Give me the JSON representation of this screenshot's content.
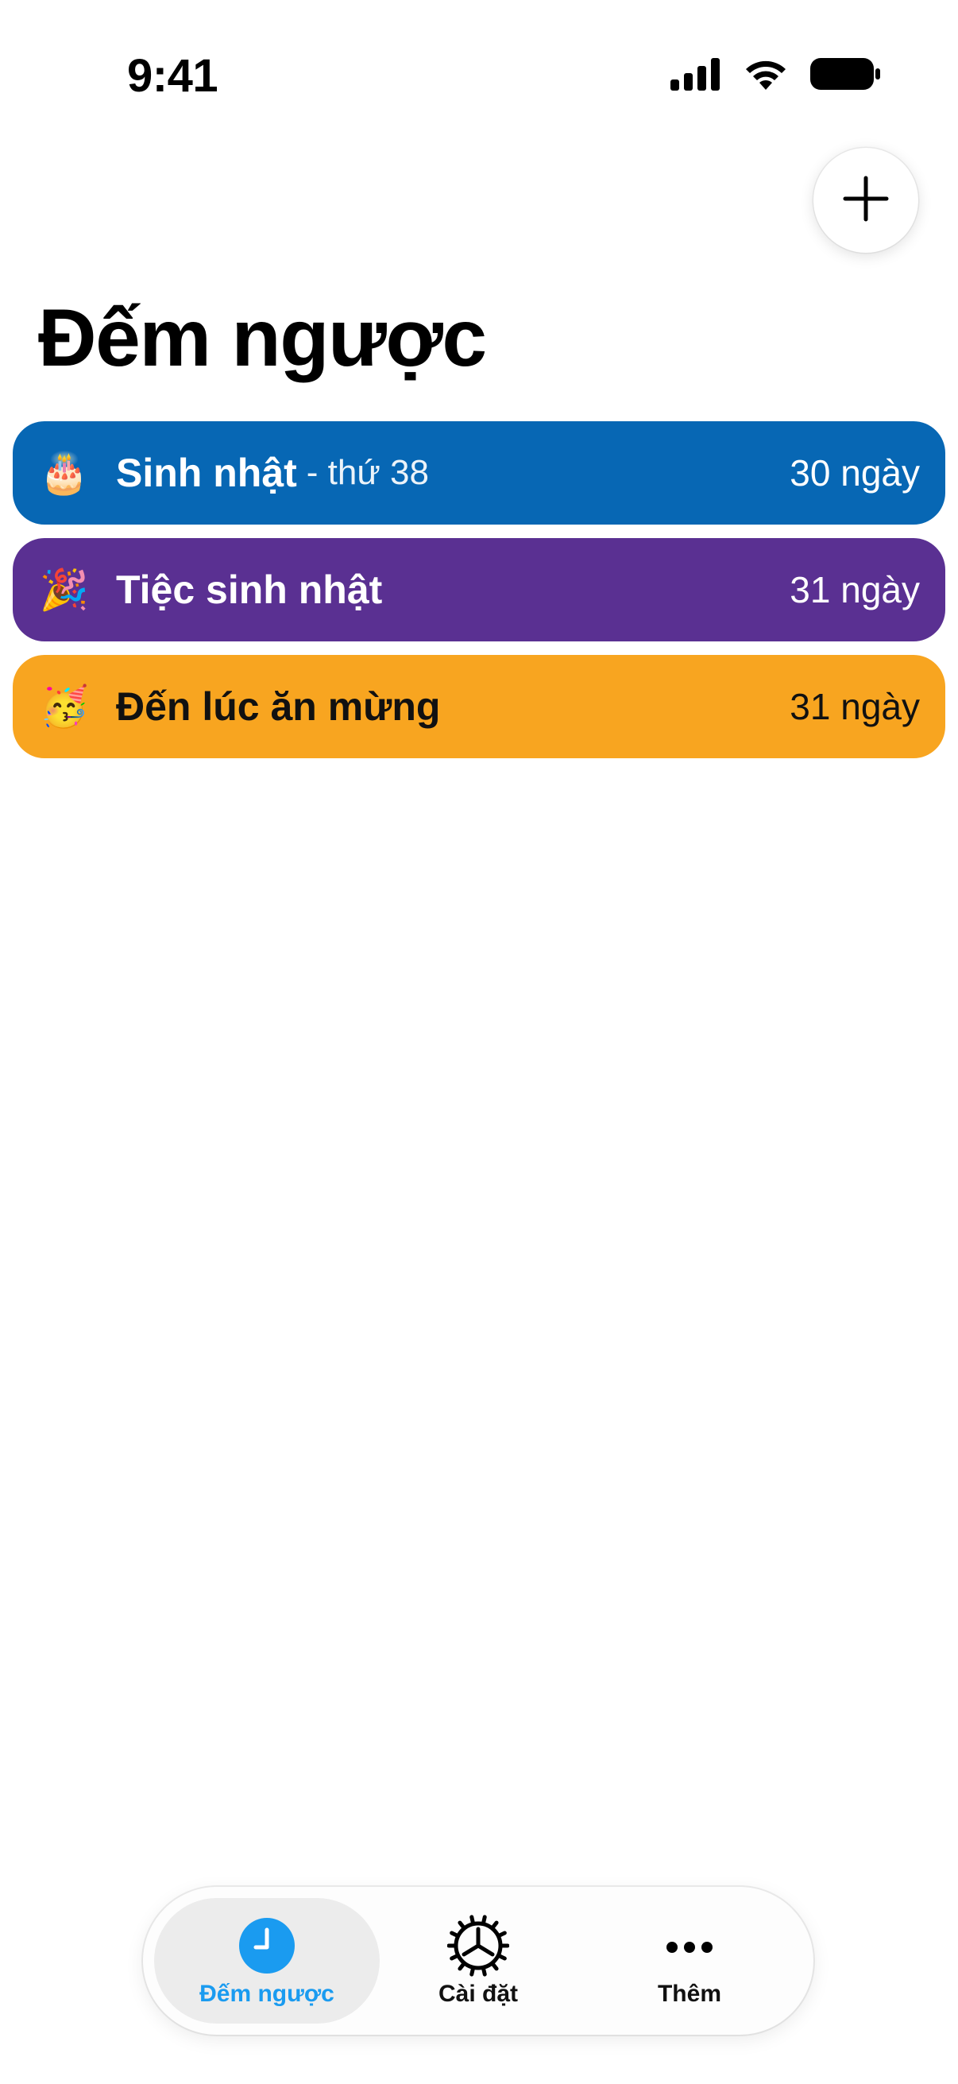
{
  "status_bar": {
    "time": "9:41",
    "icons": [
      "cellular-signal-icon",
      "wifi-icon",
      "battery-icon"
    ]
  },
  "header": {
    "add_icon": "plus-icon",
    "title": "Đếm ngược"
  },
  "countdowns": [
    {
      "emoji": "🎂",
      "icon_name": "birthday-cake-icon",
      "title": "Sinh nhật",
      "subtitle": "- thứ 38",
      "days": "30 ngày",
      "color": "#0767B4",
      "text_color": "#FFFFFF"
    },
    {
      "emoji": "🎉",
      "icon_name": "party-popper-icon",
      "title": "Tiệc sinh nhật",
      "subtitle": "",
      "days": "31 ngày",
      "color": "#5A3092",
      "text_color": "#FFFFFF"
    },
    {
      "emoji": "🥳",
      "icon_name": "partying-face-icon",
      "title": "Đến lúc ăn mừng",
      "subtitle": "",
      "days": "31 ngày",
      "color": "#F8A520",
      "text_color": "#111111"
    }
  ],
  "tab_bar": {
    "tabs": [
      {
        "label": "Đếm ngược",
        "icon": "clock-icon",
        "active": true
      },
      {
        "label": "Cài đặt",
        "icon": "gear-icon",
        "active": false
      },
      {
        "label": "Thêm",
        "icon": "more-icon",
        "active": false
      }
    ],
    "accent_color": "#1A9BF0"
  }
}
